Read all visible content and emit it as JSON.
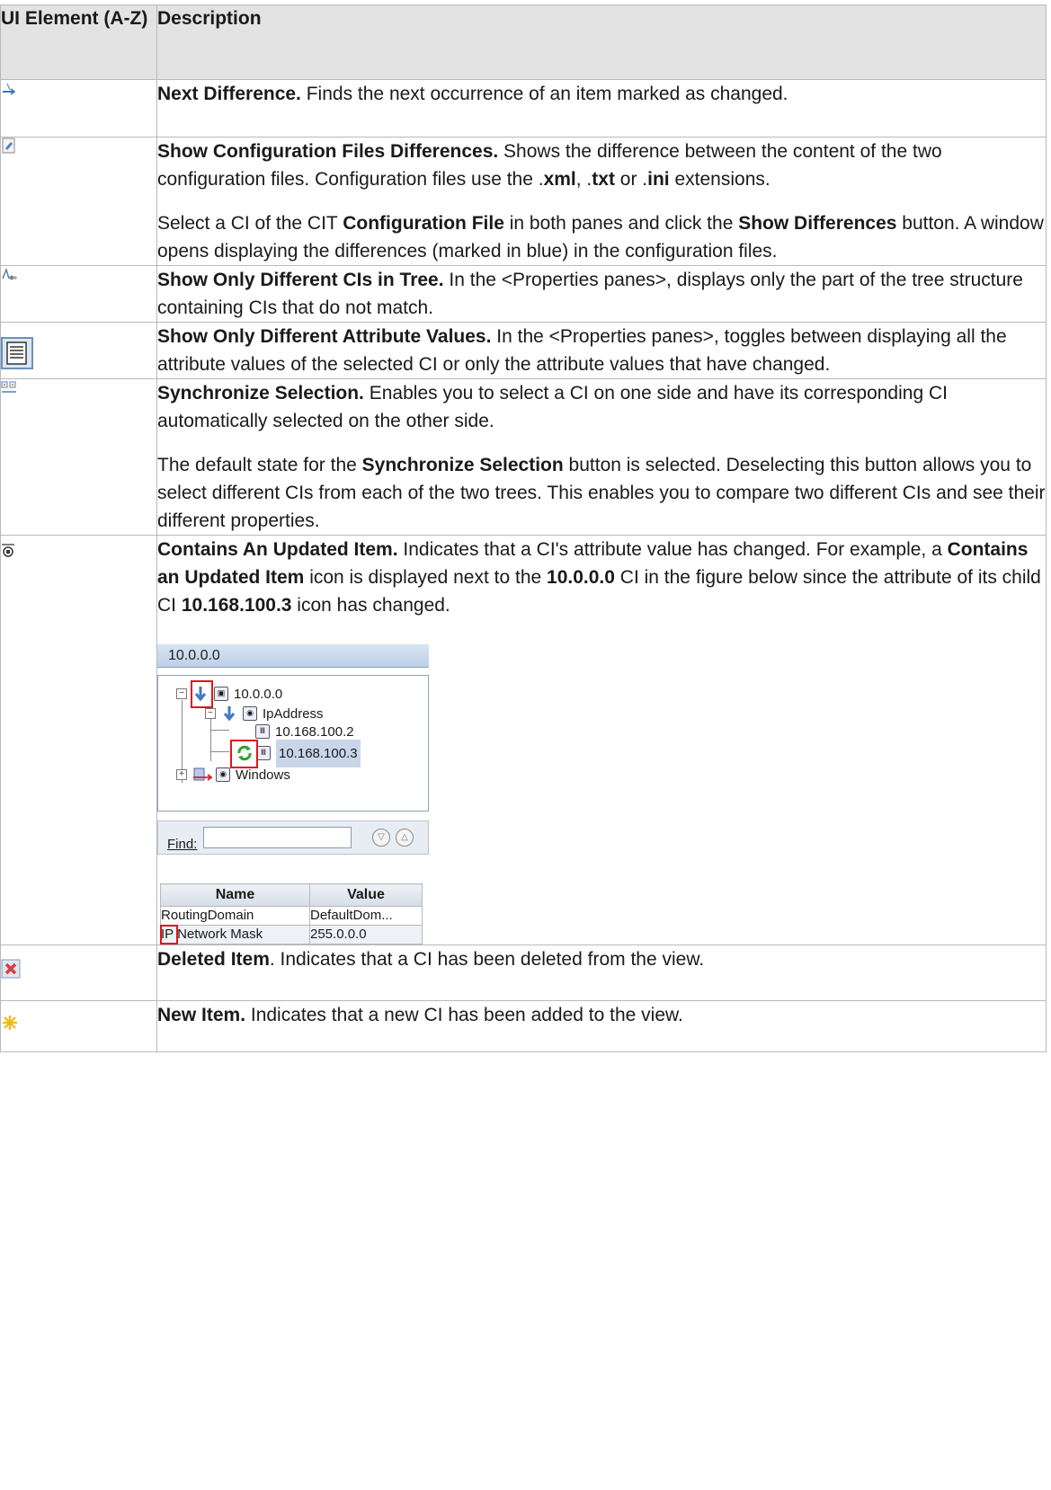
{
  "header": {
    "col1": "UI Element (A-Z)",
    "col2": "Description"
  },
  "rows": [
    {
      "icon": "next-difference-icon",
      "title": "Next Difference.",
      "text": " Finds the next occurrence of an item marked as changed."
    },
    {
      "icon": "show-config-files-differences-icon",
      "title": "Show Configuration Files Differences.",
      "p1_text1": " Shows the difference between the content of the two configuration files. Configuration files use the .",
      "p1_b1": "xml",
      "p1_text2": ", .",
      "p1_b2": "txt",
      "p1_text3": " or .",
      "p1_b3": "ini",
      "p1_text4": " extensions.",
      "p2_text1": "Select a CI of the CIT ",
      "p2_b1": "Configuration File",
      "p2_text2": " in both panes and click the ",
      "p2_b2": "Show Differences",
      "p2_text3": " button. A window opens displaying the differences (marked in blue) in the configuration files."
    },
    {
      "icon": "show-only-different-cis-icon",
      "title": "Show Only Different CIs in Tree.",
      "text": " In the <Properties panes>, displays only the part of the tree structure containing CIs that do not match."
    },
    {
      "icon": "show-only-different-attributes-icon",
      "title": "Show Only Different Attribute Values.",
      "text": " In the <Properties panes>, toggles between displaying all the attribute values of the selected CI or only the attribute values that have changed."
    },
    {
      "icon": "synchronize-selection-icon",
      "title": "Synchronize Selection.",
      "text": " Enables you to select a CI on one side and have its corresponding CI automatically selected on the other side.",
      "p2_text1": "The default state for the ",
      "p2_b1": "Synchronize Selection",
      "p2_text2": " button is selected. Deselecting this button allows you to select different CIs from each of the two trees. This enables you to compare two different CIs and see their different properties."
    },
    {
      "icon": "contains-updated-item-icon",
      "title": "Contains An Updated Item.",
      "text1": " Indicates that a CI's attribute value has changed. For example, a ",
      "b1": "Contains an Updated Item",
      "text2": " icon is displayed next to the ",
      "b2": "10.0.0.0",
      "text3": " CI in the figure below since the attribute of its child CI ",
      "b3": "10.168.100.3",
      "text4": " icon has changed.",
      "figure": {
        "tree_title": "10.0.0.0",
        "nodes": [
          "10.0.0.0",
          "IpAddress",
          "10.168.100.2",
          "10.168.100.3",
          "Windows"
        ],
        "find_label": "Find:",
        "props_headers": [
          "Name",
          "Value"
        ],
        "props_rows": [
          [
            "RoutingDomain",
            "DefaultDom..."
          ],
          [
            "IP Network Mask",
            "255.0.0.0"
          ]
        ]
      }
    },
    {
      "icon": "deleted-item-icon",
      "title": "Deleted Item",
      "text": ". Indicates that a CI has been deleted from the view."
    },
    {
      "icon": "new-item-icon",
      "title": "New Item.",
      "text": " Indicates that a new CI has been added to the view."
    }
  ]
}
